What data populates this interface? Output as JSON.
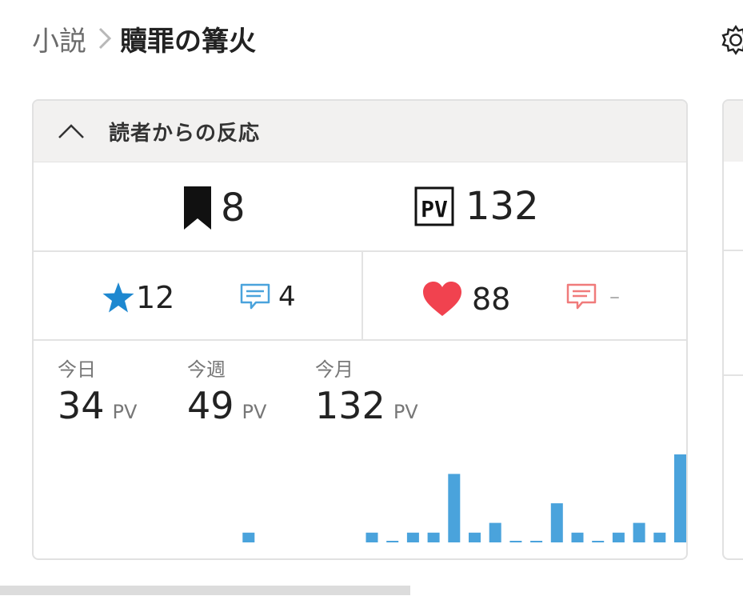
{
  "breadcrumb": {
    "parent": "小説",
    "current": "贖罪の篝火"
  },
  "reactions": {
    "title": "読者からの反応",
    "bookmarks": "8",
    "pv_total": "132",
    "stars": "12",
    "star_comments": "4",
    "hearts": "88",
    "heart_comments": "–"
  },
  "periods": [
    {
      "label": "今日",
      "value": "34",
      "unit": "PV"
    },
    {
      "label": "今週",
      "value": "49",
      "unit": "PV"
    },
    {
      "label": "今月",
      "value": "132",
      "unit": "PV"
    }
  ],
  "chart_data": {
    "type": "bar",
    "values": [
      0,
      0,
      0,
      0,
      0,
      0,
      0,
      0,
      0,
      1,
      0,
      0,
      0,
      0,
      0,
      1,
      0,
      1,
      1,
      7,
      1,
      2,
      0,
      0,
      4,
      1,
      0,
      1,
      2,
      1,
      9
    ],
    "ylim": [
      0,
      9
    ]
  },
  "colors": {
    "accent": "#4aa3dc",
    "star": "#1e88d0",
    "heart": "#f1424f",
    "heart_comment": "#f07b7b"
  }
}
